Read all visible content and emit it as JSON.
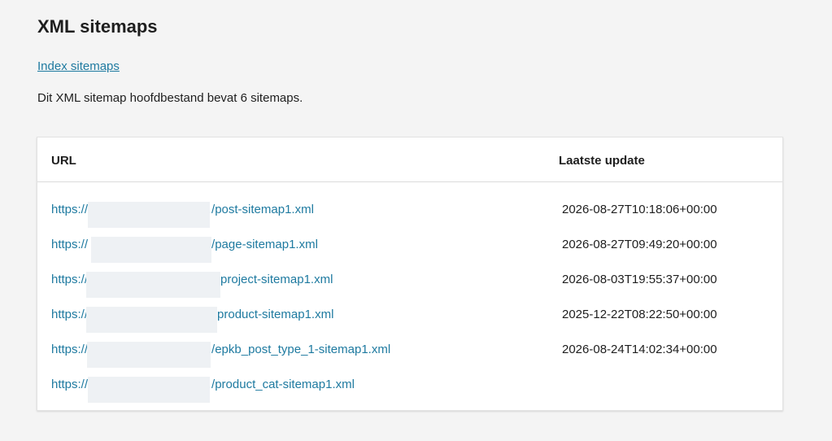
{
  "page": {
    "title": "XML sitemaps",
    "index_link": "Index sitemaps",
    "description": "Dit XML sitemap hoofdbestand bevat 6 sitemaps."
  },
  "table": {
    "headers": {
      "url": "URL",
      "last_update": "Laatste update"
    },
    "rows": [
      {
        "url_prefix": "https://",
        "url_suffix": "/post-sitemap1.xml",
        "last_update": "2026-08-27T10:18:06+00:00"
      },
      {
        "url_prefix": "https://",
        "url_suffix": "/page-sitemap1.xml",
        "last_update": "2026-08-27T09:49:20+00:00"
      },
      {
        "url_prefix": "https://",
        "url_suffix": "project-sitemap1.xml",
        "last_update": "2026-08-03T19:55:37+00:00"
      },
      {
        "url_prefix": "https://",
        "url_suffix": "product-sitemap1.xml",
        "last_update": "2025-12-22T08:22:50+00:00"
      },
      {
        "url_prefix": "https://",
        "url_suffix": "/epkb_post_type_1-sitemap1.xml",
        "last_update": "2026-08-24T14:02:34+00:00"
      },
      {
        "url_prefix": "https://",
        "url_suffix": "/product_cat-sitemap1.xml",
        "last_update": ""
      }
    ]
  },
  "colors": {
    "link": "#1e7aa0",
    "background": "#f4f4f4",
    "card": "#ffffff"
  }
}
